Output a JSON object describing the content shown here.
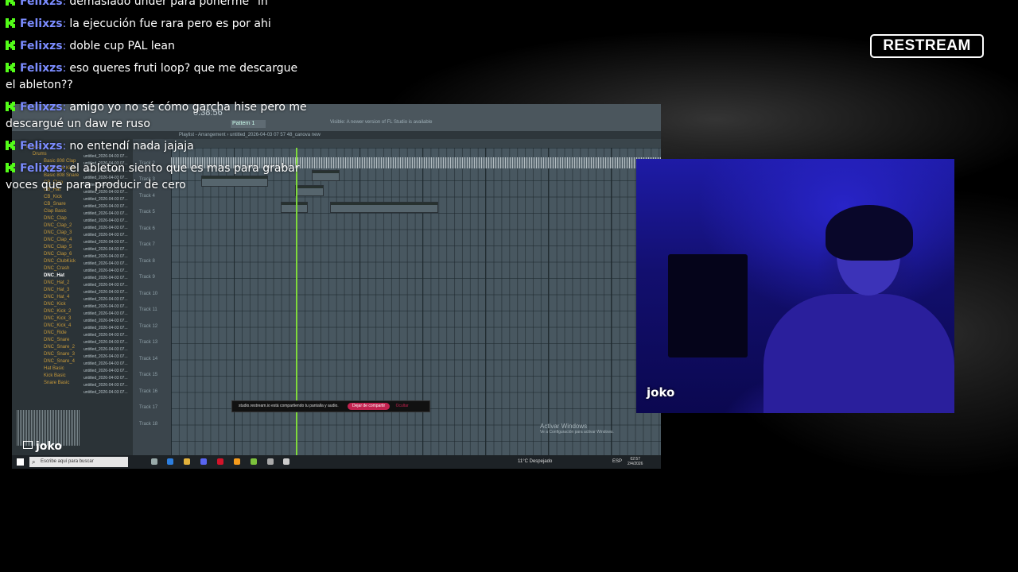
{
  "chat": {
    "messages": [
      {
        "user": "Felixzs",
        "text": "demasiado under para ponerme \"in\""
      },
      {
        "user": "Felixzs",
        "text": "la ejecución fue rara pero es por ahi"
      },
      {
        "user": "Felixzs",
        "text": "doble cup PAL lean"
      },
      {
        "user": "Felixzs",
        "text": "eso queres fruti loop? que me descargue el ableton??"
      },
      {
        "user": "Felixzs",
        "text": "amigo yo no sé cómo garcha hise pero me descargué un daw re ruso"
      },
      {
        "user": "Felixzs",
        "text": "no entendí nada jajaja"
      },
      {
        "user": "Felixzs",
        "text": "el ableton siento que es mas para grabar voces que para producir de cero"
      }
    ],
    "separator": ":",
    "platform_icon": "kick-icon",
    "user_color": "#7b8cff",
    "icon_color": "#53fc18"
  },
  "logo": {
    "text": "RESTREAM"
  },
  "screen_share": {
    "time": "0:38:56",
    "pattern": "Pattern 1",
    "info": "Visible: A newer version of FL Studio is available",
    "playlist_title": "Playlist - Arrangement › untitled_2026-04-03 07 57 48_canova new",
    "browser_items": [
      "Legacy",
      "Drums",
      "Basic 808 Clap",
      "Basic 808 Kick",
      "Basic 808 Snare",
      "CB_Clap",
      "CB_Hat",
      "CB_Kick",
      "CB_Snare",
      "Clap Basic",
      "DNC_Clap",
      "DNC_Clap_2",
      "DNC_Clap_3",
      "DNC_Clap_4",
      "DNC_Clap_5",
      "DNC_Clap_6",
      "DNC_ClubKick",
      "DNC_Crash",
      "DNC_Hat",
      "DNC_Hat_2",
      "DNC_Hat_3",
      "DNC_Hat_4",
      "DNC_Kick",
      "DNC_Kick_2",
      "DNC_Kick_3",
      "DNC_Kick_4",
      "DNC_Ride",
      "DNC_Snare",
      "DNC_Snare_2",
      "DNC_Snare_3",
      "DNC_Snare_4",
      "Hat Basic",
      "Kick Basic",
      "Snare Basic"
    ],
    "selected_item": "DNC_Hat",
    "file_label": "untitled_2026-04-03 07...",
    "track_labels": [
      "Track 1",
      "Track 2",
      "Track 3",
      "Track 4",
      "Track 5",
      "Track 6",
      "Track 7",
      "Track 8",
      "Track 9",
      "Track 10",
      "Track 11",
      "Track 12",
      "Track 13",
      "Track 14",
      "Track 15",
      "Track 16",
      "Track 17",
      "Track 18"
    ],
    "banner_text": "studio.restream.io está compartiendo tu pantalla y audio.",
    "banner_stop": "Dejar de compartir",
    "banner_hide": "Ocultar",
    "activate_title": "Activar Windows",
    "activate_sub": "Ve a Configuración para activar Windows.",
    "taskbar_search": "Escribe aquí para buscar",
    "weather": "11°C  Despejado",
    "lang": "ESP",
    "clock_time": "02:57",
    "clock_date": "2/4/2026",
    "source_name": "joko"
  },
  "webcam": {
    "name": "joko"
  }
}
